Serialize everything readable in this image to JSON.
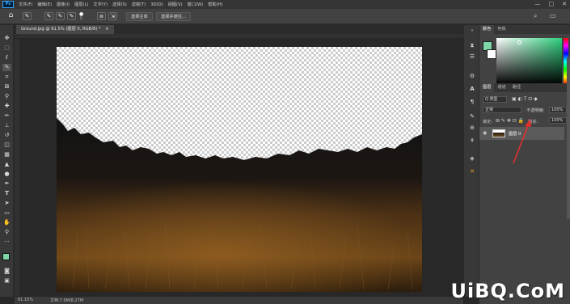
{
  "app": {
    "logo": "Ps",
    "menu": [
      "文件(F)",
      "编辑(E)",
      "图像(I)",
      "图层(L)",
      "文字(Y)",
      "选择(S)",
      "滤镜(T)",
      "3D(D)",
      "视图(V)",
      "窗口(W)",
      "帮助(H)"
    ],
    "window_controls": {
      "minimize": "—",
      "maximize": "□",
      "close": "✕"
    }
  },
  "options_bar": {
    "brush_size": "5",
    "select_subject": "选择主体",
    "select_and_mask": "选择并遮住..."
  },
  "document": {
    "tab_title": "Ground.jpg @ 61.5% (图层 0, RGB/8) *",
    "tab_close": "×",
    "zoom": "61.15%",
    "doc_info": "文档:7.0M/8.27M"
  },
  "colors": {
    "foreground": "#7fd6a8",
    "background": "#ffffff",
    "picker_accent": "#2ed07e",
    "arrow": "#e03030"
  },
  "color_panel": {
    "tabs": [
      "颜色",
      "色板"
    ]
  },
  "layers_panel": {
    "tabs": [
      "图层",
      "通道",
      "路径"
    ],
    "filter_label": "Q 类型",
    "blend_mode": "正常",
    "opacity_label": "不透明度:",
    "opacity_value": "100%",
    "lock_label": "锁定:",
    "fill_label": "填充:",
    "fill_value": "100%",
    "layer_name": "图层 0"
  },
  "watermark": "UiBQ.CoM"
}
